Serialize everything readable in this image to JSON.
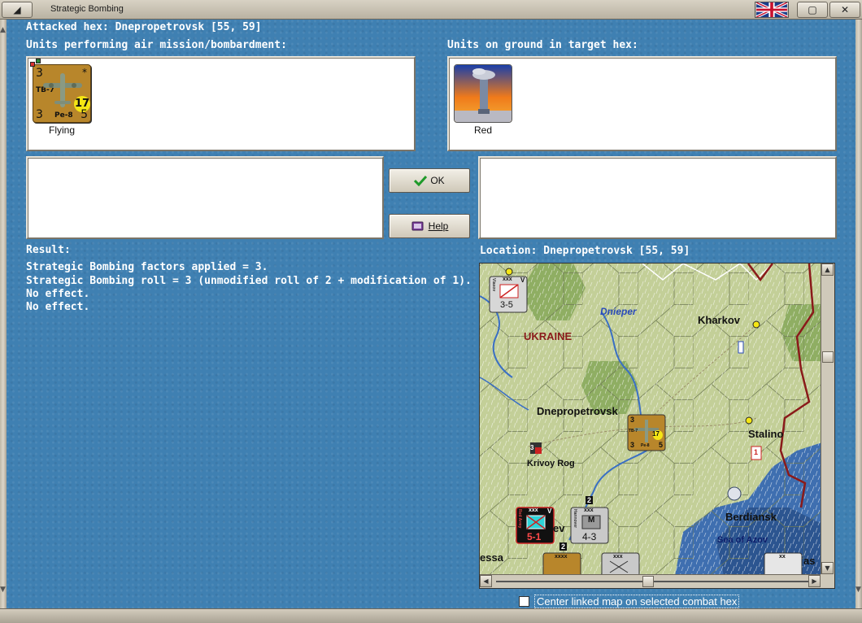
{
  "window": {
    "title": "Strategic Bombing",
    "title_btn_left": "◢",
    "title_btn_right": "▢",
    "close_label": "✕"
  },
  "attacked_hex": "Attacked hex: Dnepropetrovsk  [55, 59]",
  "air_units": {
    "heading": "Units performing air mission/bombardment:",
    "units": [
      {
        "attack": "3",
        "defense": "3",
        "range": "5",
        "top_code": "TB-7",
        "bottom_code": "Pe-8",
        "moves": "17",
        "star": "*",
        "caption": "Flying"
      }
    ]
  },
  "ground_units": {
    "heading": "Units on ground in target hex:",
    "units": [
      {
        "caption": "Red"
      }
    ]
  },
  "buttons": {
    "ok": "OK",
    "help": "Help"
  },
  "result": {
    "heading": "Result:",
    "lines": [
      "Strategic Bombing factors applied = 3.",
      "Strategic Bombing roll = 3 (unmodified roll of 2 + modification of 1).",
      "No effect.",
      "No effect."
    ]
  },
  "location": "Location:  Dnepropetrovsk  [55, 59]",
  "map": {
    "labels": {
      "ukraine": "UKRAINE",
      "dnieper": "Dnieper",
      "kharkov": "Kharkov",
      "dnepropetrovsk": "Dnepropetrovsk",
      "stalino": "Stalino",
      "krivoy_rog": "Krivoy Rog",
      "berdiansk": "Berdiansk",
      "sea_of_azov": "Sea of Azov",
      "kiev_fragment": "ev",
      "odessa_fragment": "essa",
      "right_fragment": "as"
    },
    "counters": {
      "vlasov": {
        "size": "xxx",
        "corps": "V",
        "strength": "3-5",
        "side": "Vlasov"
      },
      "red_army": {
        "size": "xxx",
        "corps": "V",
        "strength": "5-1",
        "side": "Red Army"
      },
      "hannover": {
        "size": "xxx",
        "strength": "4-3",
        "mark": "M",
        "stack": "2",
        "side": "Hannover"
      },
      "bomber": {
        "attack": "3",
        "range": "5",
        "moves": "17",
        "top_code": "TB-7",
        "bottom_code": "Pe-8"
      },
      "bottom_a": {
        "size": "xxxx",
        "stack": "2"
      },
      "bottom_b": {
        "size": "xxx"
      },
      "bottom_c": {
        "size": "xx"
      },
      "krivoy_marker": "3",
      "stalino_marker": "1"
    }
  },
  "checkbox": {
    "label": "Center linked map on selected combat hex",
    "checked": false
  },
  "colors": {
    "background": "#3f80b2",
    "panel": "#ffffff",
    "counter_soviet": "#b8862b",
    "ukraine_text": "#8a1a1a",
    "river": "#3a6fc4",
    "sea": "#2f5f9f"
  }
}
